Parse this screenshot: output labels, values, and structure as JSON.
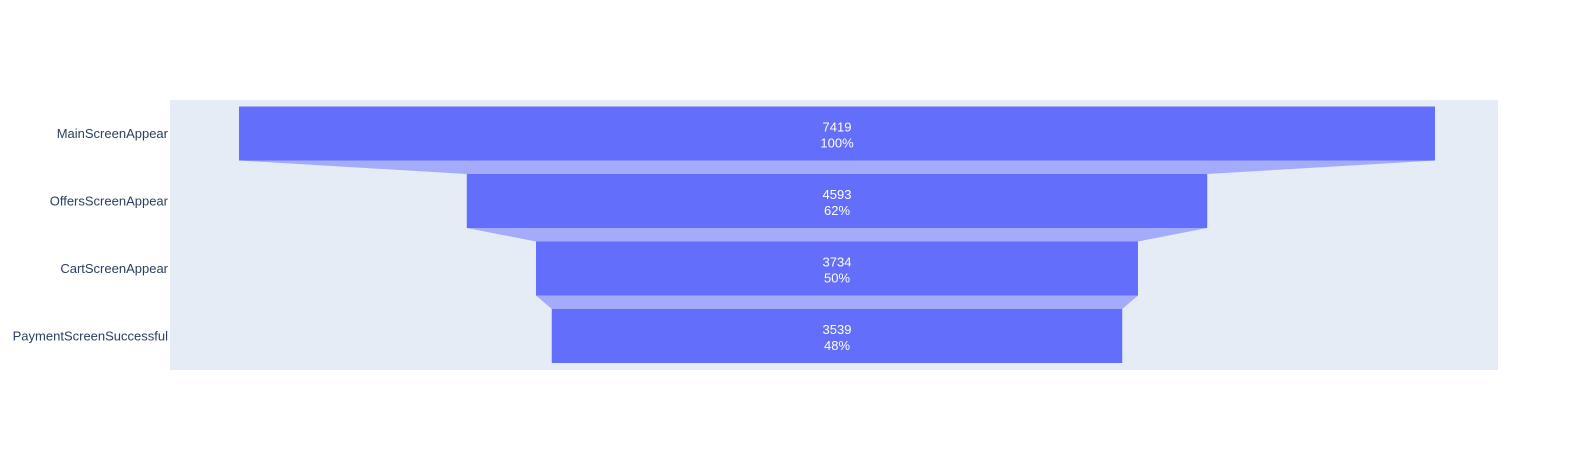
{
  "chart_data": {
    "type": "funnel",
    "title": "",
    "categories": [
      "MainScreenAppear",
      "OffersScreenAppear",
      "CartScreenAppear",
      "PaymentScreenSuccessful"
    ],
    "values": [
      7419,
      4593,
      3734,
      3539
    ],
    "percent_initial": [
      "100%",
      "62%",
      "50%",
      "48%"
    ],
    "colors": {
      "bar": "#636efa",
      "connector": "#a5abfb",
      "plot_background": "#e5ecf6",
      "label_text": "#ffffff",
      "axis_text": "#2a3f5f"
    },
    "grid": false,
    "legend": "none"
  }
}
